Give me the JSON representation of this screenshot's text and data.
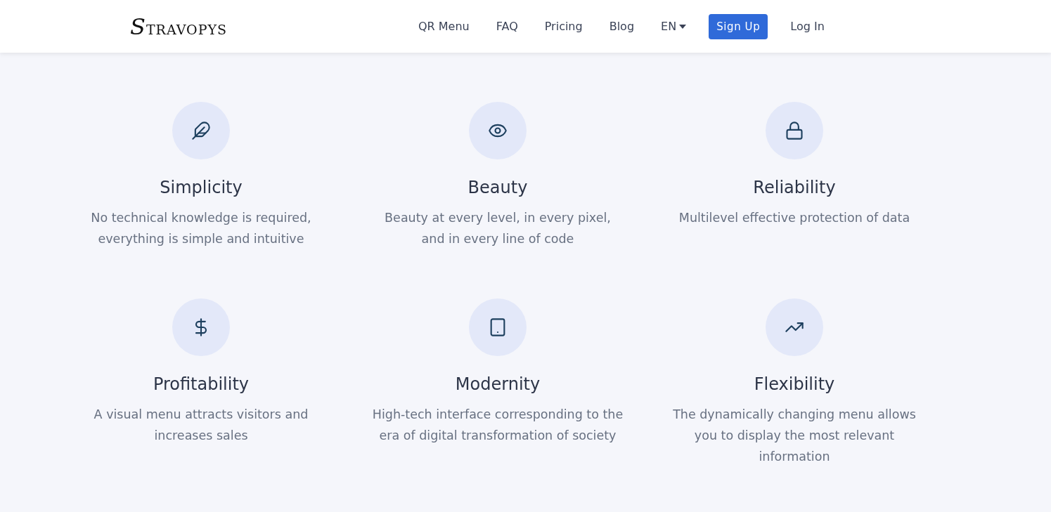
{
  "header": {
    "logo": "STRAVOPYS",
    "nav": [
      {
        "label": "QR Menu",
        "kind": "link"
      },
      {
        "label": "FAQ",
        "kind": "link"
      },
      {
        "label": "Pricing",
        "kind": "link"
      },
      {
        "label": "Blog",
        "kind": "link"
      },
      {
        "label": "EN",
        "kind": "dropdown"
      },
      {
        "label": "Sign Up",
        "kind": "button"
      },
      {
        "label": "Log In",
        "kind": "link"
      }
    ]
  },
  "features": [
    {
      "kind": "feather",
      "title": "Simplicity",
      "text": "No technical knowledge is required, everything is simple and intuitive"
    },
    {
      "kind": "eye",
      "title": "Beauty",
      "text": "Beauty at every level, in every pixel, and in every line of code"
    },
    {
      "kind": "lock",
      "title": "Reliability",
      "text": "Multilevel effective protection of data"
    },
    {
      "kind": "dollar",
      "title": "Profitability",
      "text": "A visual menu attracts visitors and increases sales"
    },
    {
      "kind": "tablet",
      "title": "Modernity",
      "text": "High-tech interface corresponding to the era of digital transformation of society"
    },
    {
      "kind": "trend",
      "title": "Flexibility",
      "text": "The dynamically changing menu allows you to display the most relevant information"
    }
  ]
}
